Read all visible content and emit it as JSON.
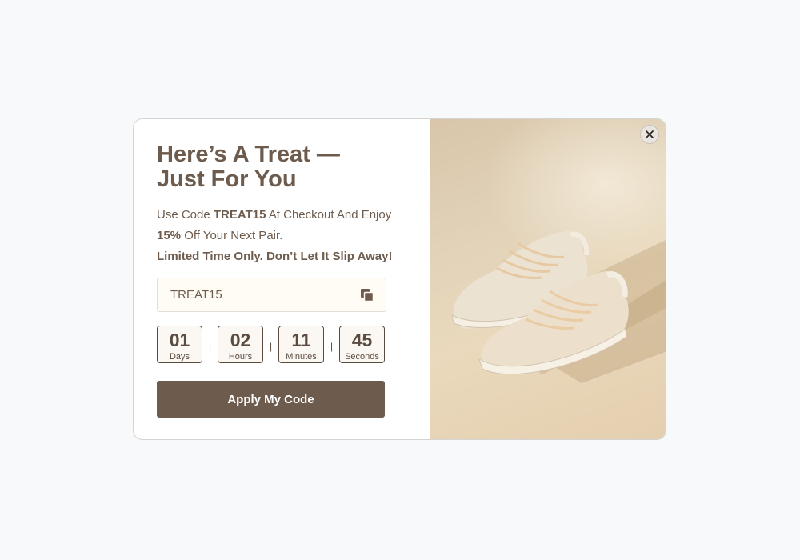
{
  "popup": {
    "headline_line1": "Here’s A Treat —",
    "headline_line2": "Just For You",
    "desc_use_code": "Use Code ",
    "desc_code": "TREAT15",
    "desc_at_checkout": " At Checkout And Enjoy",
    "desc_percent": "15%",
    "desc_off": " Off Your Next Pair.",
    "desc_urgency": "Limited Time Only. Don’t Let It Slip Away!",
    "code_value": "TREAT15",
    "copy_icon": "copy-icon",
    "apply_label": "Apply My Code",
    "close_icon": "close-icon"
  },
  "countdown": [
    {
      "value": "01",
      "label": "Days"
    },
    {
      "value": "02",
      "label": "Hours"
    },
    {
      "value": "11",
      "label": "Minutes"
    },
    {
      "value": "45",
      "label": "Seconds"
    }
  ],
  "separator": "|",
  "colors": {
    "brand": "#6d5b4d",
    "text_dark": "#5b4a3e",
    "field_bg": "#fffcf6",
    "page_bg": "#f8f9fb"
  }
}
